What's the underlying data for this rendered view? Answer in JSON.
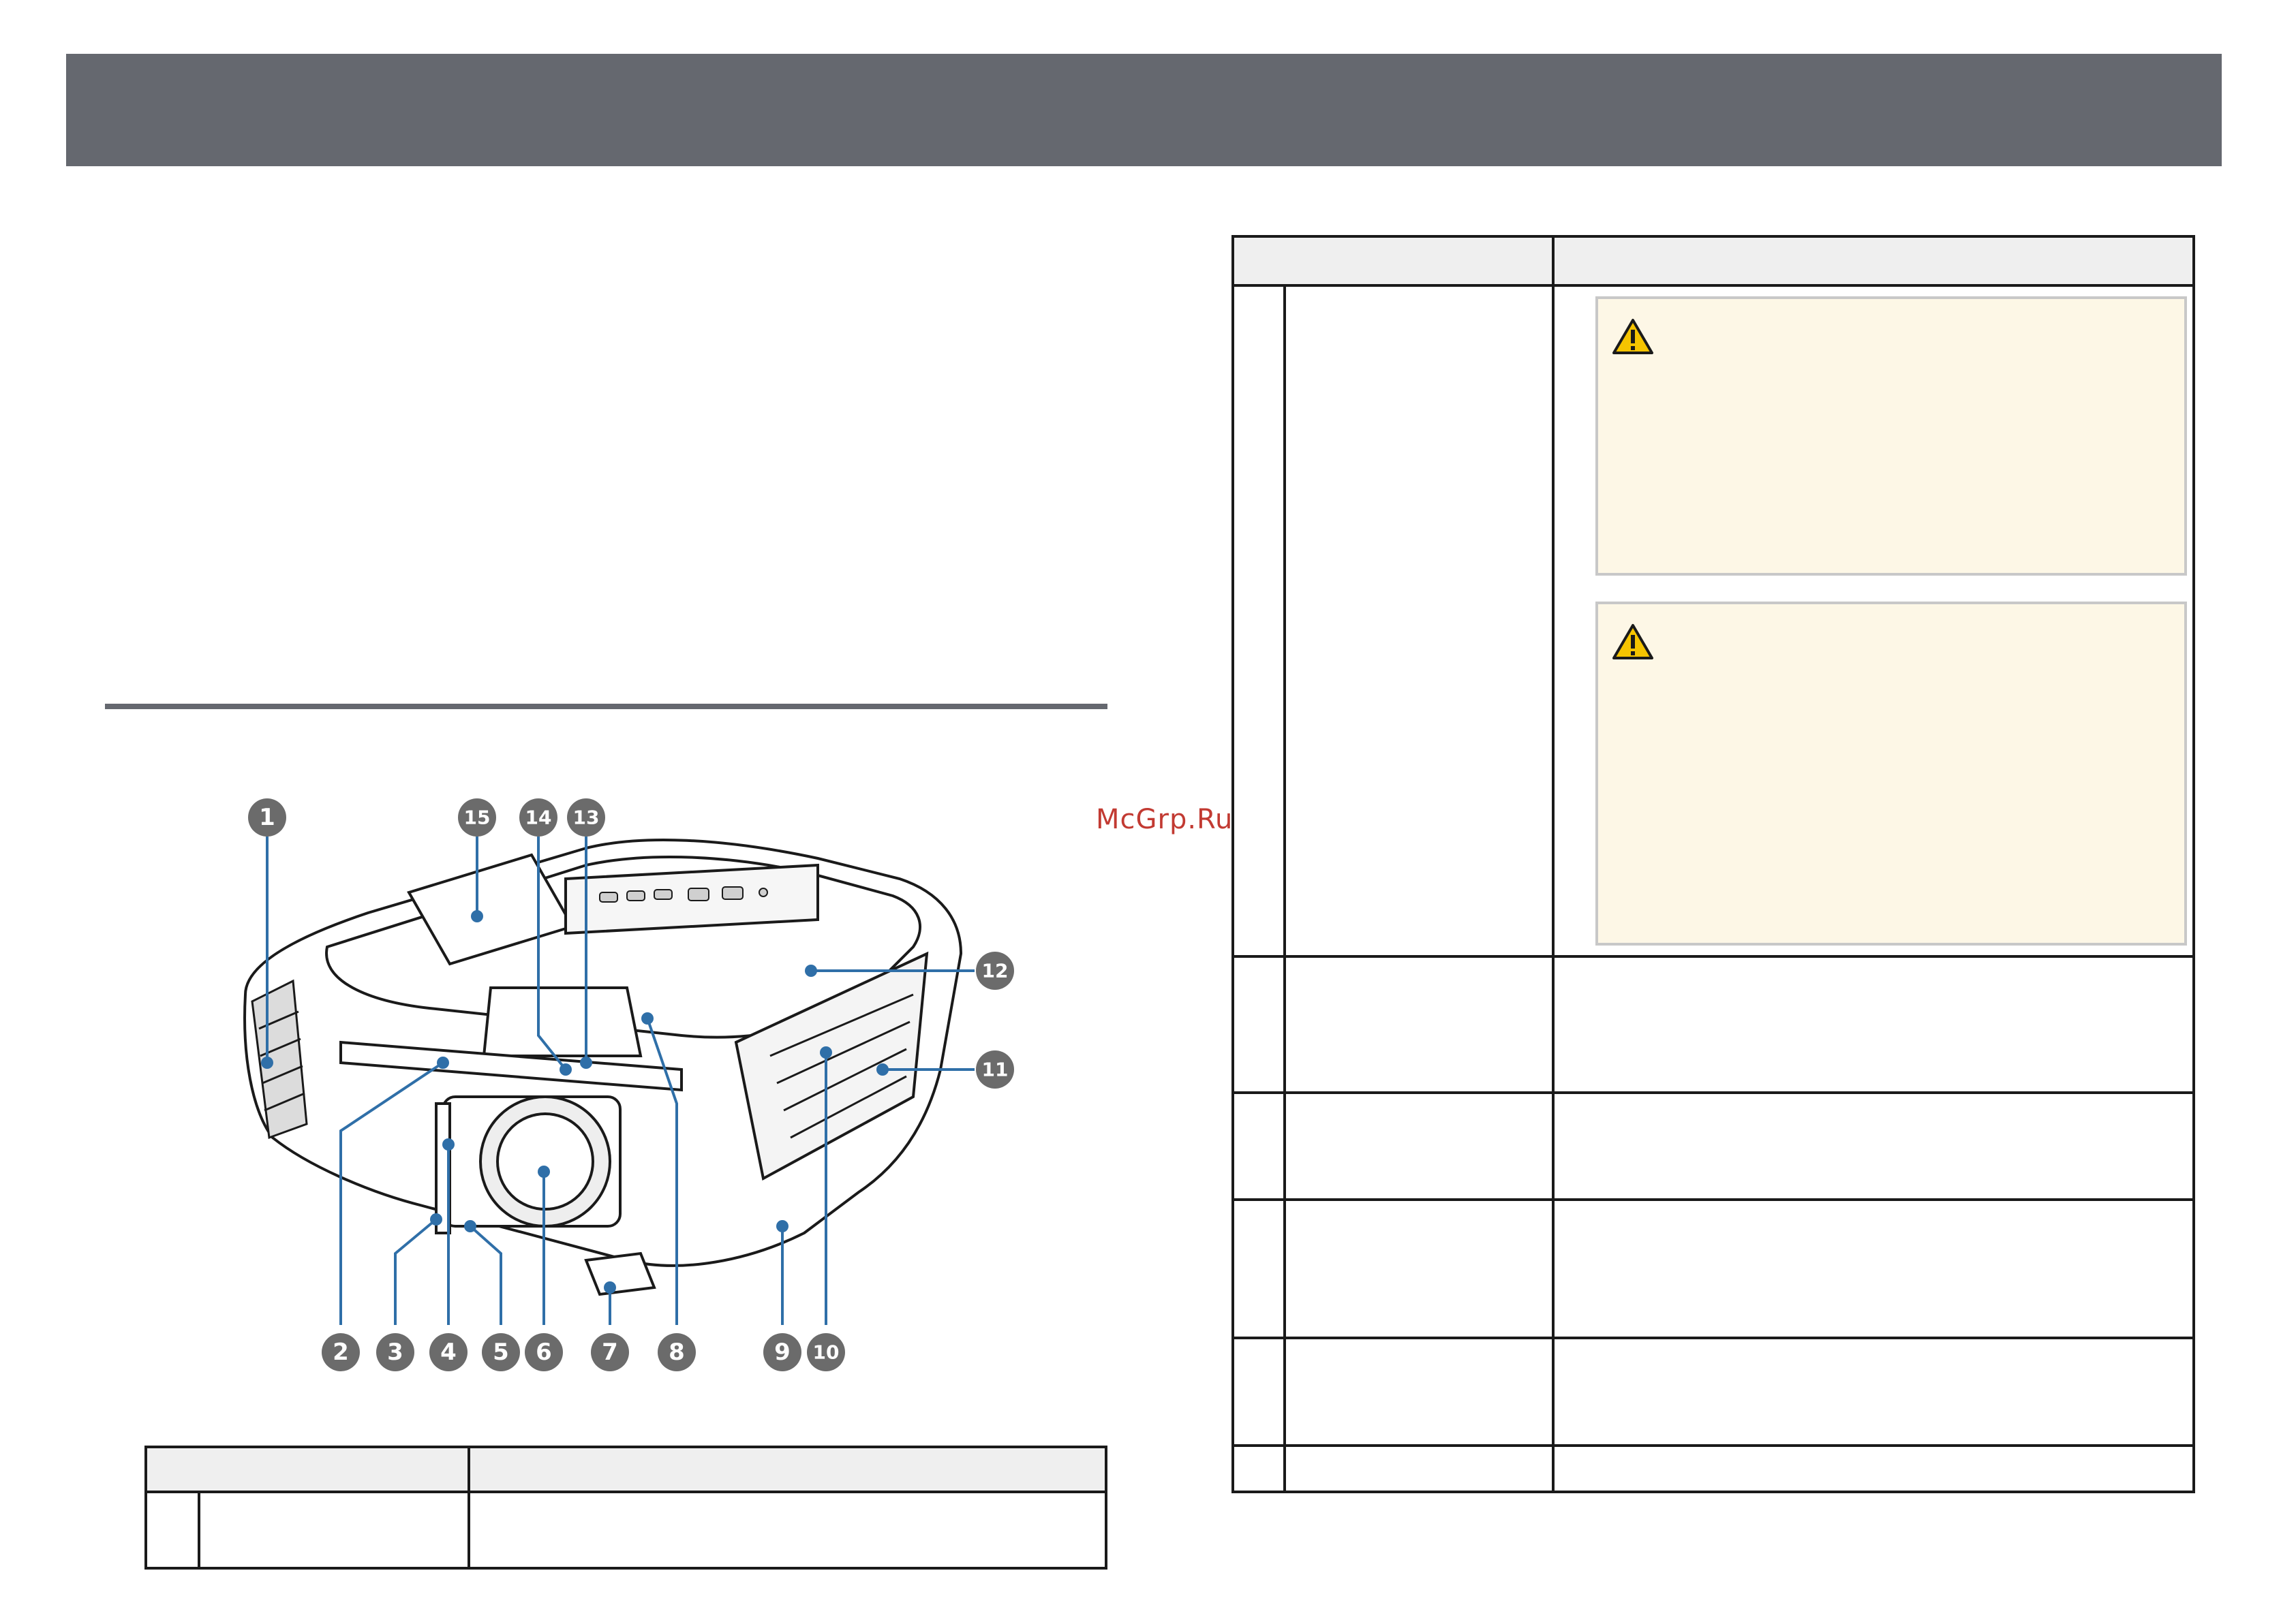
{
  "page": {
    "watermark": "McGrp.Ru"
  },
  "callouts": [
    "1",
    "2",
    "3",
    "4",
    "5",
    "6",
    "7",
    "8",
    "9",
    "10",
    "11",
    "12",
    "13",
    "14",
    "15"
  ],
  "colors": {
    "header": "#65686f",
    "caution_bg": "#fdf7e6",
    "leader": "#2f6fa8",
    "callout": "#6b6b6b"
  },
  "icons": {
    "caution": "warning-triangle-icon"
  }
}
